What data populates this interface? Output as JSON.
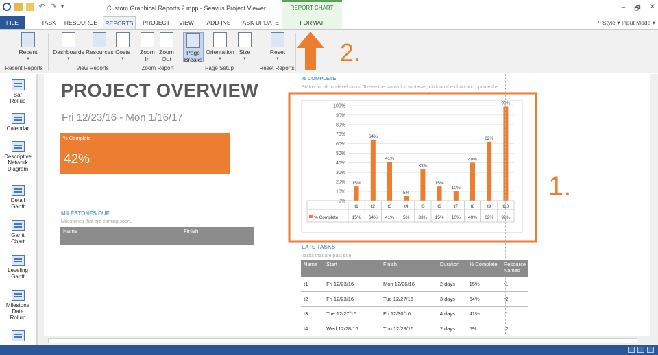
{
  "titlebar": {
    "doc_title": "Custom Graphical Reports 2.mpp - Seavus Project Viewer",
    "context_tools": "REPORT CHART TOOLS",
    "minimize": "–",
    "restore": "🗗",
    "close": "✕",
    "undo": "↶",
    "redo": "↷",
    "more": "▾"
  },
  "tabs": {
    "file": "FILE",
    "task": "TASK",
    "resource": "RESOURCE",
    "reports": "REPORTS",
    "project": "PROJECT",
    "view": "VIEW",
    "addins": "ADD-INS",
    "task_update": "TASK UPDATE",
    "format": "FORMAT"
  },
  "style_menu": "^ Style ▾ Input Mode ▾",
  "ribbon": {
    "recent": "Recent",
    "dashboards": "Dashboards",
    "resources": "Resources",
    "costs": "Costs",
    "zoom_in_1": "Zoom",
    "zoom_in_2": "In",
    "zoom_out_1": "Zoom",
    "zoom_out_2": "Out",
    "page_breaks_1": "Page",
    "page_breaks_2": "Breaks",
    "orientation": "Orientation",
    "size": "Size",
    "reset": "Reset",
    "groups": {
      "recent_reports": "Recent Reports",
      "view_reports": "View Reports",
      "zoom_report": "Zoom Report",
      "page_setup": "Page Setup",
      "reset_reports": "Reset Reports"
    }
  },
  "viewbar": [
    {
      "l1": "Bar",
      "l2": "Rollup",
      "l3": ""
    },
    {
      "l1": "Calendar",
      "l2": "",
      "l3": ""
    },
    {
      "l1": "Descriptive",
      "l2": "Network",
      "l3": "Diagram"
    },
    {
      "l1": "Detail",
      "l2": "Gantt",
      "l3": ""
    },
    {
      "l1": "Gantt",
      "l2": "Chart",
      "l3": ""
    },
    {
      "l1": "Leveling",
      "l2": "Gantt",
      "l3": ""
    },
    {
      "l1": "Milestone",
      "l2": "Date",
      "l3": "Rollup"
    }
  ],
  "report": {
    "title": "PROJECT OVERVIEW",
    "dates": "Fri 12/23/16 - Mon 1/16/17",
    "kpi_label": "% Complete",
    "kpi_value": "42%",
    "milestones_title": "MILESTONES DUE",
    "milestones_sub": "Milestones that are coming soon.",
    "ms_col_name": "Name",
    "ms_col_finish": "Finish",
    "chart_title": "% COMPLETE",
    "chart_sub": "Status for all top-level tasks. To see the status for subtasks, click on the chart and update the",
    "late_title": "LATE TASKS",
    "late_sub": "Tasks that are past due.",
    "late_columns": [
      "Name",
      "Start",
      "Finish",
      "Duration",
      "% Complete",
      "Resource Names"
    ],
    "late_rows": [
      [
        "t1",
        "Fri 12/23/16",
        "Mon 12/26/16",
        "2 days",
        "15%",
        "r1"
      ],
      [
        "t2",
        "Fri 12/23/16",
        "Tue 12/27/16",
        "3 days",
        "64%",
        "r2"
      ],
      [
        "t3",
        "Tue 12/27/16",
        "Fri 12/30/16",
        "4 days",
        "41%",
        "r1"
      ],
      [
        "t4",
        "Wed 12/28/16",
        "Thu 12/29/16",
        "2 days",
        "5%",
        "r2"
      ]
    ]
  },
  "annotations": {
    "one": "1.",
    "two": "2."
  },
  "colors": {
    "accent": "#ed7d31",
    "brand": "#2b579a",
    "heading": "#5b9bd5"
  },
  "chart_data": {
    "type": "bar",
    "title": "",
    "categories": [
      "t1",
      "t2",
      "t3",
      "t4",
      "t5",
      "t6",
      "t7",
      "t8",
      "t9",
      "t10"
    ],
    "series": [
      {
        "name": "% Complete",
        "values": [
          15,
          64,
          41,
          5,
          33,
          15,
          10,
          40,
          62,
          99
        ]
      }
    ],
    "value_labels": [
      "15%",
      "64%",
      "41%",
      "5%",
      "33%",
      "15%",
      "10%",
      "40%",
      "62%",
      "99%"
    ],
    "yticks": [
      "0%",
      "10%",
      "20%",
      "30%",
      "40%",
      "50%",
      "60%",
      "70%",
      "80%",
      "90%",
      "100%"
    ],
    "ylim": [
      0,
      100
    ],
    "grid": true,
    "legend": "data-table-bottom",
    "color": "#ed7d31"
  }
}
